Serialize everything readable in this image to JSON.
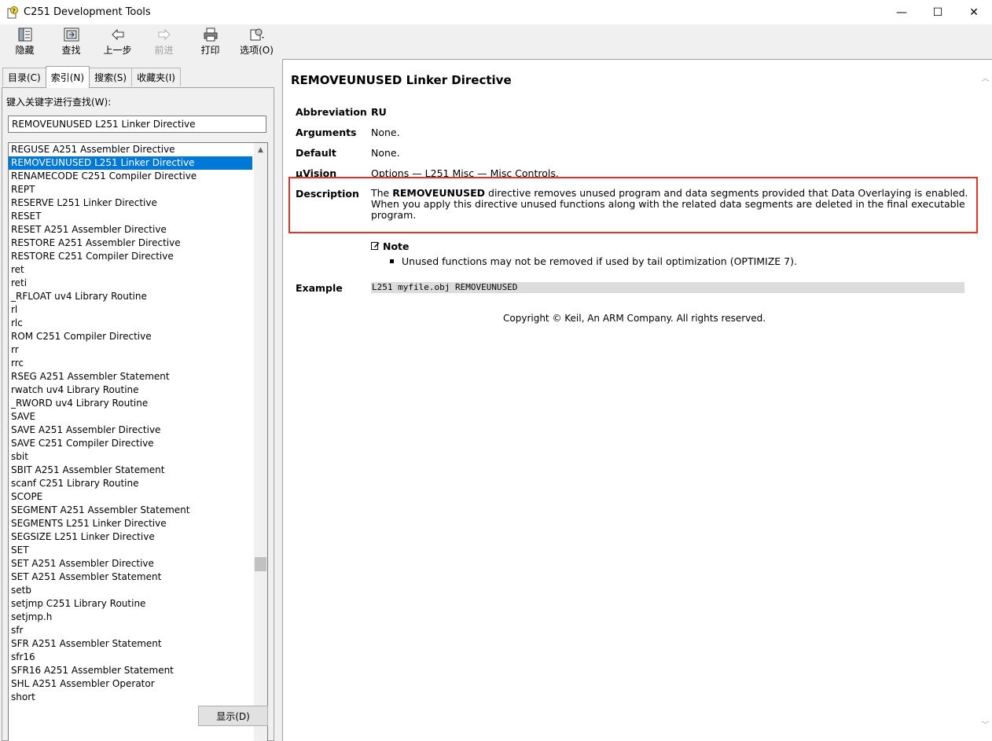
{
  "window": {
    "title": "C251 Development Tools",
    "controls": {
      "minimize": "—",
      "maximize": "☐",
      "close": "✕"
    }
  },
  "toolbar": {
    "buttons": [
      {
        "label": "隐藏",
        "icon": "hide-icon"
      },
      {
        "label": "查找",
        "icon": "locate-icon"
      },
      {
        "label": "上一步",
        "icon": "back-arrow-icon"
      },
      {
        "label": "前进",
        "icon": "forward-arrow-icon"
      },
      {
        "label": "打印",
        "icon": "printer-icon"
      },
      {
        "label": "选项(O)",
        "icon": "options-icon"
      }
    ]
  },
  "left": {
    "tabs": [
      "目录(C)",
      "索引(N)",
      "搜索(S)",
      "收藏夹(I)"
    ],
    "active_tab": "索引(N)",
    "keyword_label": "键入关键字进行查找(W):",
    "keyword_value": "REMOVEUNUSED L251 Linker Directive",
    "items": [
      "REGUSE A251 Assembler Directive",
      "REMOVEUNUSED L251 Linker Directive",
      "RENAMECODE C251 Compiler Directive",
      "REPT",
      "RESERVE L251 Linker Directive",
      "RESET",
      "RESET A251 Assembler Directive",
      "RESTORE A251 Assembler Directive",
      "RESTORE C251 Compiler Directive",
      "ret",
      "reti",
      "_RFLOAT uv4 Library Routine",
      "rl",
      "rlc",
      "ROM C251 Compiler Directive",
      "rr",
      "rrc",
      "RSEG A251 Assembler Statement",
      "rwatch uv4 Library Routine",
      "_RWORD uv4 Library Routine",
      "SAVE",
      "SAVE A251 Assembler Directive",
      "SAVE C251 Compiler Directive",
      "sbit",
      "SBIT A251 Assembler Statement",
      "scanf C251 Library Routine",
      "SCOPE",
      "SEGMENT A251 Assembler Statement",
      "SEGMENTS L251 Linker Directive",
      "SEGSIZE L251 Linker Directive",
      "SET",
      "SET A251 Assembler Directive",
      "SET A251 Assembler Statement",
      "setb",
      "setjmp C251 Library Routine",
      "setjmp.h",
      "sfr",
      "SFR A251 Assembler Statement",
      "sfr16",
      "SFR16 A251 Assembler Statement",
      "SHL A251 Assembler Operator",
      "short"
    ],
    "selected_index": 1,
    "show_button": "显示(D)"
  },
  "content": {
    "heading": "REMOVEUNUSED Linker Directive",
    "abbreviation_key": "Abbreviation",
    "abbreviation_val": "RU",
    "arguments_key": "Arguments",
    "arguments_val": "None.",
    "default_key": "Default",
    "default_val": "None.",
    "uvision_key": "µVision",
    "uvision_val": "Options — L251 Misc — Misc Controls.",
    "description_key": "Description",
    "description_pre": "The ",
    "description_bold": "REMOVEUNUSED",
    "description_post": " directive removes unused program and data segments provided that Data Overlaying is enabled. When you apply this directive unused functions along with the related data segments are deleted in the final executable program.",
    "note_title": "Note",
    "note_item": "Unused functions may not be removed if used by tail optimization (OPTIMIZE 7).",
    "example_key": "Example",
    "example_code": "L251 myfile.obj REMOVEUNUSED",
    "copyright": "Copyright © Keil, An ARM Company. All rights reserved.",
    "highlight_color": "#e53323"
  }
}
